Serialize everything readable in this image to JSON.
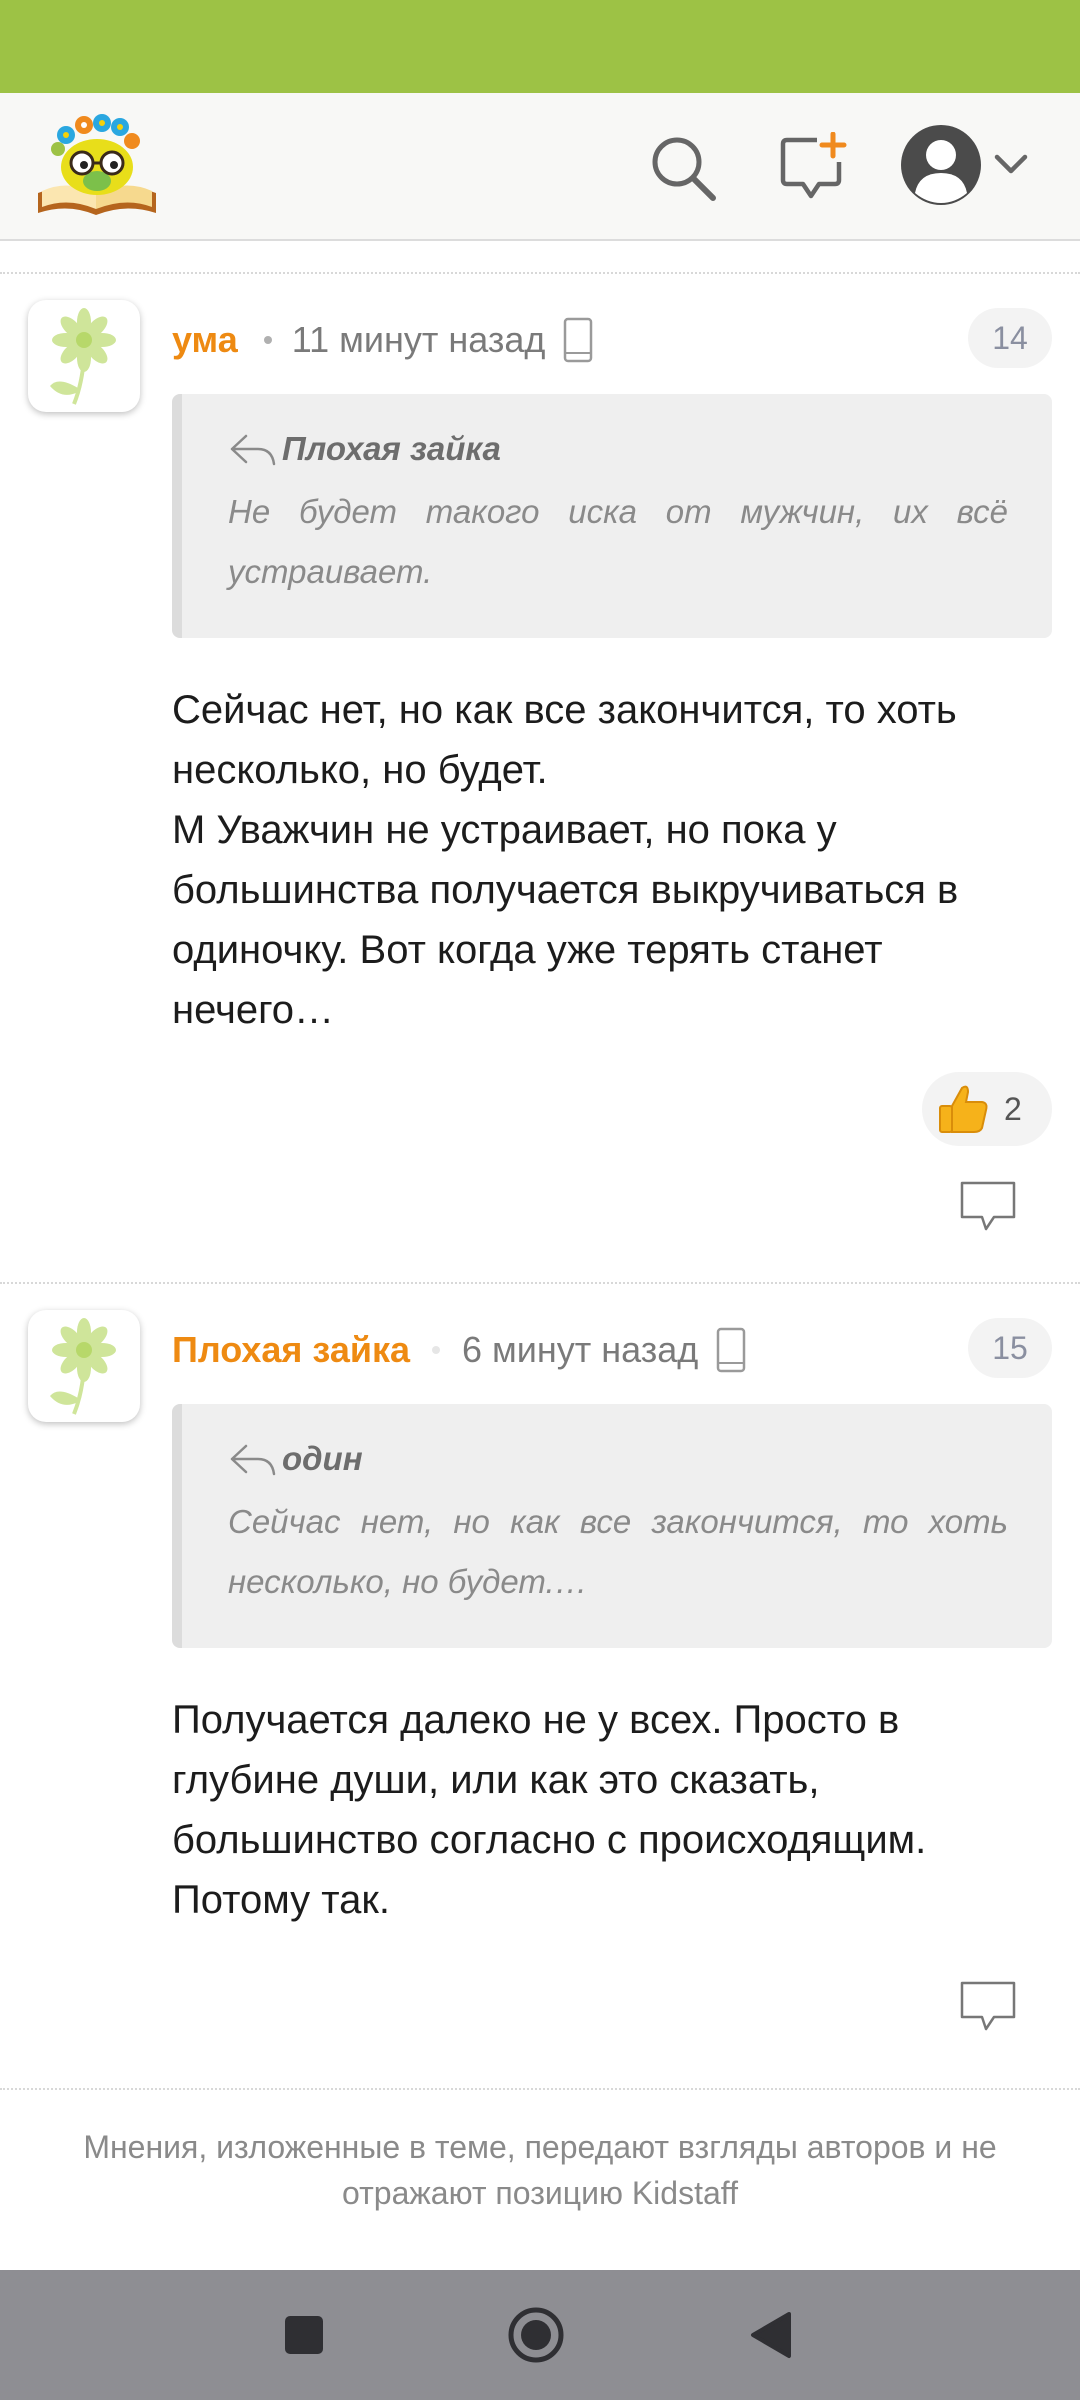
{
  "header": {
    "icons": [
      "site-logo",
      "search-icon",
      "new-topic-icon",
      "user-avatar-icon",
      "chevron-down-icon"
    ]
  },
  "posts": [
    {
      "author": "ума",
      "time": "11 минут назад",
      "number": "14",
      "quote": {
        "author": "Плохая зайка",
        "text": "Не будет такого иска от мужчин, их всё устраивает."
      },
      "body": "Сейчас нет, но как все закончится, то хоть несколько, но будет.\nМ Уважчин не устраивает, но пока у большинства получается выкручиваться в одиночку. Вот когда уже терять станет нечего…",
      "likes": "2"
    },
    {
      "author": "Плохая зайка",
      "time": "6 минут назад",
      "number": "15",
      "quote": {
        "author": "один",
        "text": "Сейчас нет, но как все закончится, то хоть несколько, но будет.…"
      },
      "body": "Получается далеко не у всех. Просто в глубине души, или как это сказать, большинство согласно с происходящим. Потому так."
    }
  ],
  "disclaimer": "Мнения, изложенные в теме, передают взгляды авторов и не отражают позицию Kidstaff",
  "colors": {
    "status_bar": "#9dc245",
    "author": "#ee8a12",
    "nav_bar": "#8e8e93"
  }
}
